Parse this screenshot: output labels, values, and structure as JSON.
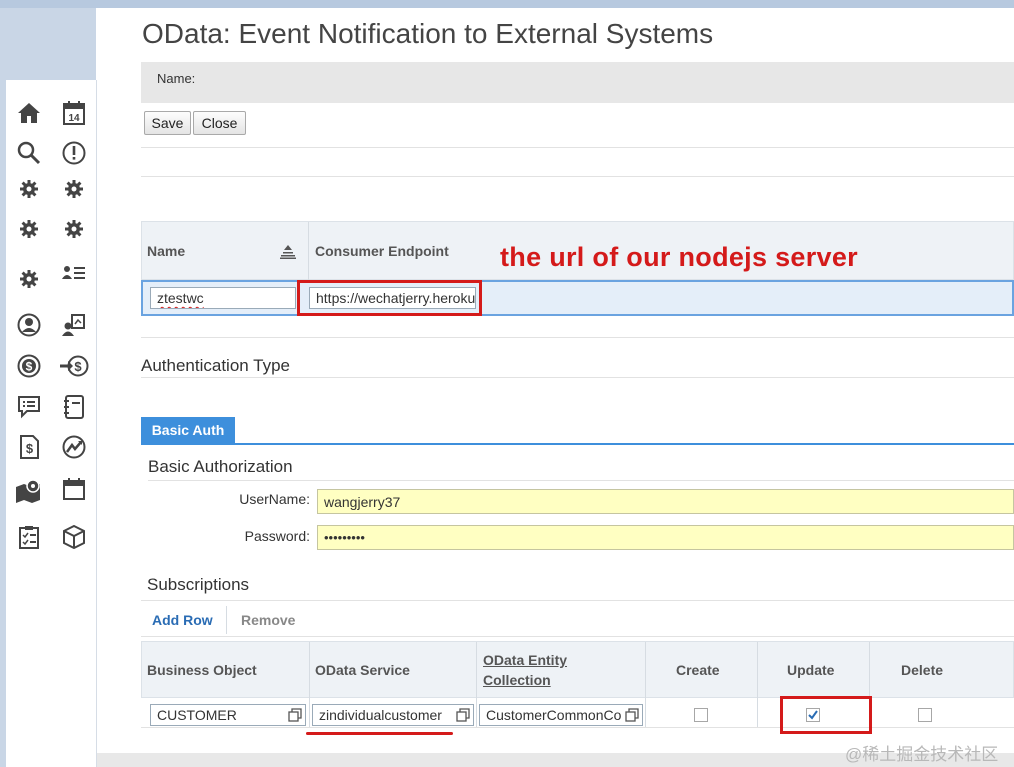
{
  "window": {
    "title": "OData: Event Notification to External Systems"
  },
  "header": {
    "name_label": "Name:"
  },
  "toolbar": {
    "save_label": "Save",
    "close_label": "Close"
  },
  "consumer_table": {
    "columns": [
      "Name",
      "Consumer Endpoint"
    ],
    "row": {
      "name": "ztestwc",
      "endpoint": "https://wechatjerry.heroku"
    }
  },
  "annotation": {
    "text": "the url of our nodejs server"
  },
  "auth": {
    "section_title": "Authentication Type",
    "tab_label": "Basic Auth",
    "subsection_title": "Basic Authorization",
    "username_label": "UserName:",
    "username_value": "wangjerry37",
    "password_label": "Password:",
    "password_value": "•••••••••"
  },
  "subscriptions": {
    "title": "Subscriptions",
    "add_row_label": "Add Row",
    "remove_label": "Remove",
    "columns": [
      "Business Object",
      "OData Service",
      "OData Entity",
      "Collection",
      "Create",
      "Update",
      "Delete"
    ],
    "row": {
      "business_object": "CUSTOMER",
      "odata_service": "zindividualcustomer",
      "entity_collection": "CustomerCommonCo",
      "create": false,
      "update": true,
      "delete": false
    }
  },
  "watermark": {
    "text": "@稀土掘金技术社区"
  },
  "sidebar": {
    "icons": [
      "home-icon",
      "calendar-icon",
      "search-icon",
      "alert-icon",
      "gear-icon",
      "gear-icon",
      "gear-icon",
      "gear-icon",
      "gear-icon",
      "user-list-icon",
      "person-circle-icon",
      "user-board-icon",
      "dollar-circle-icon",
      "transfer-dollar-icon",
      "chat-list-icon",
      "notebook-icon",
      "invoice-dollar-icon",
      "chart-circle-icon",
      "map-location-icon",
      "calendar-blank-icon",
      "clipboard-checklist-icon",
      "package-box-icon"
    ]
  },
  "colors": {
    "accent": "#3d8fdc",
    "highlight": "#d41a1a",
    "field_yellow": "#ffffc2",
    "row_selected": "#e4eef9"
  }
}
